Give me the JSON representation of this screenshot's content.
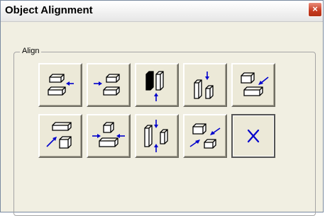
{
  "window": {
    "title": "Object Alignment",
    "close_label": "×"
  },
  "group": {
    "label": "Align"
  },
  "buttons": [
    {
      "name": "align-left-button",
      "icon": "align-left-icon"
    },
    {
      "name": "align-right-button",
      "icon": "align-right-icon"
    },
    {
      "name": "align-bottom-button",
      "icon": "align-bottom-icon"
    },
    {
      "name": "align-top-button",
      "icon": "align-top-icon"
    },
    {
      "name": "align-top-right-button",
      "icon": "align-top-right-icon"
    },
    {
      "name": "align-bottom-left-button",
      "icon": "align-bottom-left-icon"
    },
    {
      "name": "align-horizontal-center-button",
      "icon": "align-horizontal-center-icon"
    },
    {
      "name": "align-vertical-center-button",
      "icon": "align-vertical-center-icon"
    },
    {
      "name": "align-center-button",
      "icon": "align-center-icon"
    },
    {
      "name": "close-dialog-button",
      "icon": "x-icon"
    }
  ],
  "colors": {
    "arrow": "#0000cc",
    "face": "#ffffff",
    "edge": "#000000"
  }
}
